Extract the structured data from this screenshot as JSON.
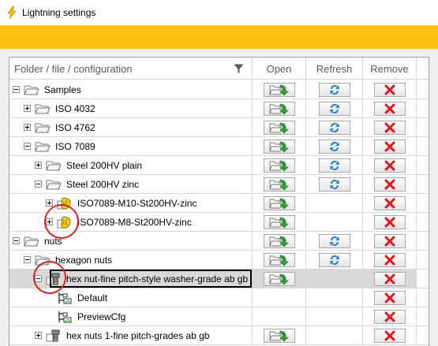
{
  "window": {
    "title": "Lightning settings"
  },
  "columns": {
    "name": "Folder / file / configuration",
    "open": "Open",
    "refresh": "Refresh",
    "remove": "Remove"
  },
  "colors": {
    "banner": "#ffc20e",
    "remove": "#e8101a",
    "refresh": "#2a7fd4",
    "open_arrow": "#2e9e2e",
    "annotation": "#e02020"
  },
  "rows": [
    {
      "label": "Samples",
      "level": 0,
      "expander": "minus",
      "icon": "folder-icon",
      "open": true,
      "refresh": true,
      "remove": true,
      "selected": false
    },
    {
      "label": "ISO 4032",
      "level": 1,
      "expander": "plus",
      "icon": "folder-icon",
      "open": true,
      "refresh": true,
      "remove": true,
      "selected": false
    },
    {
      "label": "ISO 4762",
      "level": 1,
      "expander": "plus",
      "icon": "folder-icon",
      "open": true,
      "refresh": true,
      "remove": true,
      "selected": false
    },
    {
      "label": "ISO 7089",
      "level": 1,
      "expander": "minus",
      "icon": "folder-icon",
      "open": true,
      "refresh": true,
      "remove": true,
      "selected": false
    },
    {
      "label": "Steel 200HV plain",
      "level": 2,
      "expander": "plus",
      "icon": "folder-icon",
      "open": true,
      "refresh": true,
      "remove": true,
      "selected": false
    },
    {
      "label": "Steel 200HV zinc",
      "level": 2,
      "expander": "minus",
      "icon": "folder-icon",
      "open": true,
      "refresh": true,
      "remove": true,
      "selected": false
    },
    {
      "label": "ISO7089-M10-St200HV-zinc",
      "level": 3,
      "expander": "plus",
      "icon": "washer-part-icon",
      "open": true,
      "refresh": false,
      "remove": true,
      "selected": false
    },
    {
      "label": "ISO7089-M8-St200HV-zinc",
      "level": 3,
      "expander": "plus",
      "icon": "washer-part-icon",
      "open": true,
      "refresh": false,
      "remove": true,
      "selected": false
    },
    {
      "label": "nuts",
      "level": 0,
      "expander": "minus",
      "icon": "folder-icon",
      "open": true,
      "refresh": true,
      "remove": true,
      "selected": false
    },
    {
      "label": "hexagon nuts",
      "level": 1,
      "expander": "minus",
      "icon": "folder-icon",
      "open": true,
      "refresh": true,
      "remove": true,
      "selected": false
    },
    {
      "label": "hex nut-fine pitch-style washer-grade ab gb",
      "level": 2,
      "expander": "minus",
      "icon": "bolt-part-icon",
      "open": true,
      "refresh": false,
      "remove": true,
      "selected": true
    },
    {
      "label": "Default",
      "level": 3,
      "expander": "none",
      "icon": "configuration-icon",
      "open": false,
      "refresh": false,
      "remove": true,
      "selected": false
    },
    {
      "label": "PreviewCfg",
      "level": 3,
      "expander": "none",
      "icon": "configuration-icon",
      "open": false,
      "refresh": false,
      "remove": true,
      "selected": false
    },
    {
      "label": "hex nuts 1-fine pitch-grades ab gb",
      "level": 2,
      "expander": "plus",
      "icon": "bolt-part-icon",
      "open": true,
      "refresh": false,
      "remove": true,
      "selected": false
    }
  ]
}
